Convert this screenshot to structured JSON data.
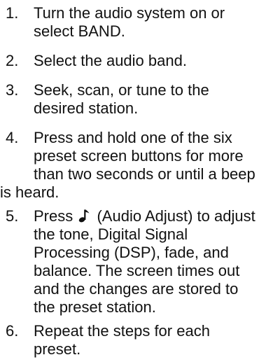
{
  "steps": [
    {
      "number": "1.",
      "lines": [
        "Turn the audio system on or",
        "select BAND."
      ]
    },
    {
      "number": "2.",
      "lines": [
        "Select the audio band."
      ]
    },
    {
      "number": "3.",
      "lines": [
        "Seek, scan, or tune to the",
        "desired station."
      ]
    },
    {
      "number": "4.",
      "lines": [
        "Press and hold one of the six",
        "preset screen buttons for more",
        "than two seconds or until a beep",
        "is heard."
      ]
    },
    {
      "number": "5.",
      "line1_prefix": "Press ",
      "line1_suffix": " (Audio Adjust) to adjust",
      "icon": "music-note-icon",
      "lines": [
        "the tone, Digital Signal",
        "Processing (DSP), fade, and",
        "balance. The screen times out",
        "and the changes are stored to",
        "the preset station."
      ]
    },
    {
      "number": "6.",
      "lines": [
        "Repeat the steps for each",
        "preset."
      ]
    }
  ]
}
